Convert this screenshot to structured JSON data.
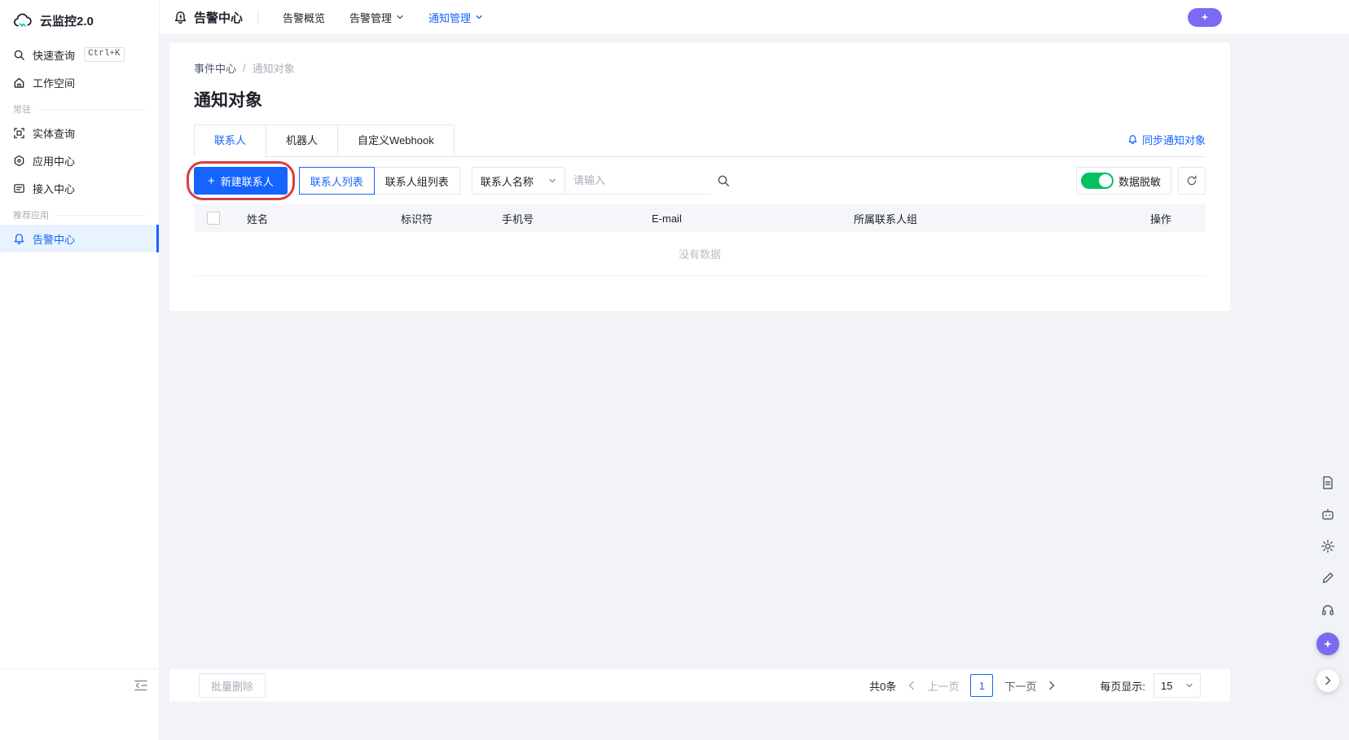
{
  "colors": {
    "primary": "#1664ff",
    "toggle_on": "#00c25e",
    "purple": "#7b6bf2",
    "annotation_red": "#dc3c42",
    "content_bg": "#f2f3f7"
  },
  "sidebar": {
    "logo_text": "云监控2.0",
    "quick_search_label": "快速查询",
    "quick_search_shortcut": "Ctrl+K",
    "workspace_label": "工作空间",
    "section_resident": "常驻",
    "resident_items": [
      {
        "label": "实体查询"
      },
      {
        "label": "应用中心"
      },
      {
        "label": "接入中心"
      }
    ],
    "section_recommended": "推荐应用",
    "alarm_center_label": "告警中心"
  },
  "header": {
    "app_title": "告警中心",
    "nav": [
      {
        "label": "告警概览"
      },
      {
        "label": "告警管理"
      },
      {
        "label": "通知管理"
      }
    ]
  },
  "page": {
    "breadcrumb": {
      "parent": "事件中心",
      "separator": "/",
      "current": "通知对象"
    },
    "title": "通知对象",
    "tabs": [
      {
        "label": "联系人"
      },
      {
        "label": "机器人"
      },
      {
        "label": "自定义Webhook"
      }
    ],
    "sync_link": "同步通知对象"
  },
  "toolbar": {
    "create_label": "新建联系人",
    "plus_glyph": "+",
    "view_contact_list": "联系人列表",
    "view_group_list": "联系人组列表",
    "filter_field": "联系人名称",
    "search_placeholder": "请输入",
    "mask_label": "数据脱敏"
  },
  "table": {
    "columns": [
      "姓名",
      "标识符",
      "手机号",
      "E-mail",
      "所属联系人组",
      "操作"
    ],
    "empty_text": "没有数据"
  },
  "pagination": {
    "batch_delete": "批量删除",
    "total": "共0条",
    "prev": "上一页",
    "current_page": "1",
    "next": "下一页",
    "per_page_label": "每页显示:",
    "per_page_value": "15"
  }
}
